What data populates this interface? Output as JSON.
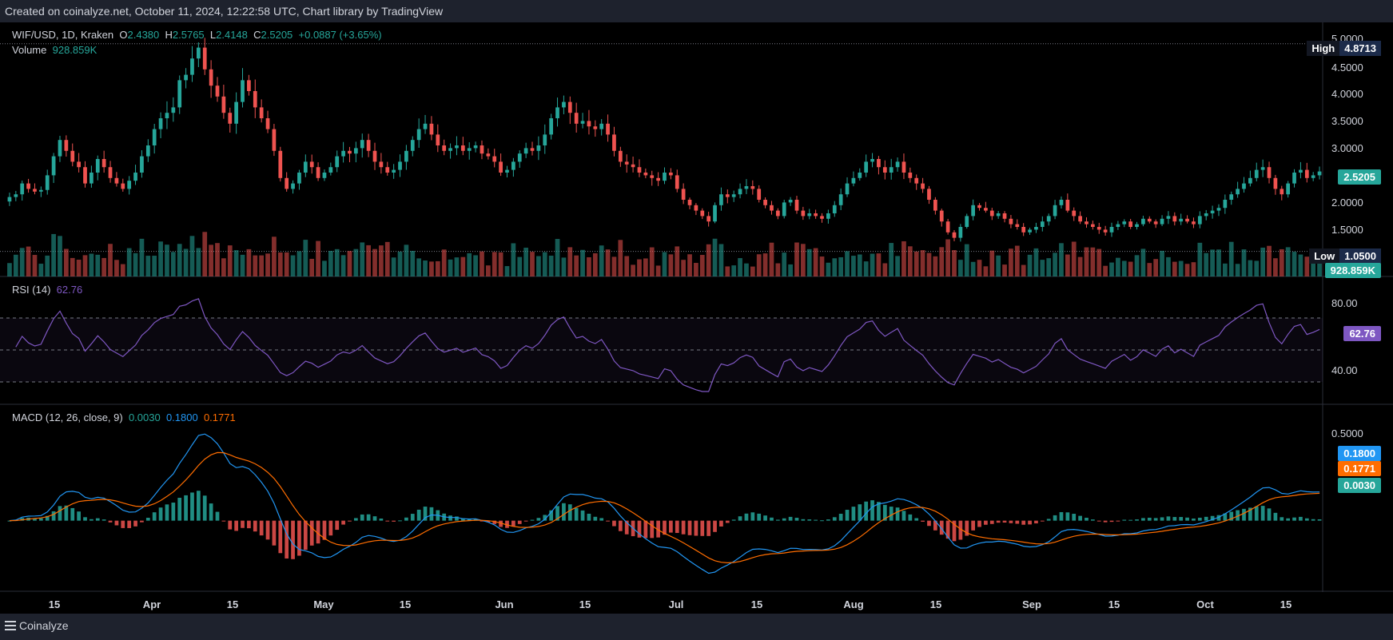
{
  "header": {
    "credit": "Created on coinalyze.net, October 11, 2024, 12:22:58 UTC, Chart library by TradingView"
  },
  "legend": {
    "symbol": "WIF/USD, 1D, Kraken",
    "o_label": "O",
    "o": "2.4380",
    "h_label": "H",
    "h": "2.5765",
    "l_label": "L",
    "l": "2.4148",
    "c_label": "C",
    "c": "2.5205",
    "change": "+0.0887 (+3.65%)",
    "volume_label": "Volume",
    "volume": "928.859K",
    "rsi_label": "RSI (14)",
    "rsi": "62.76",
    "macd_label": "MACD (12, 26, close, 9)",
    "macd_hist": "0.0030",
    "macd_line": "0.1800",
    "macd_signal": "0.1771"
  },
  "price_axis": [
    "5.0000",
    "4.5000",
    "4.0000",
    "3.5000",
    "3.0000",
    "2.5000",
    "2.0000",
    "1.5000"
  ],
  "rsi_axis": [
    "80.00",
    "40.00"
  ],
  "macd_axis": [
    "0.5000"
  ],
  "markers": {
    "high_label": "High",
    "high": "4.8713",
    "low_label": "Low",
    "low": "1.0500",
    "last_price": "2.5205",
    "last_volume": "928.859K",
    "last_rsi": "62.76",
    "macd_line_tag": "0.1800",
    "macd_signal_tag": "0.1771",
    "macd_hist_tag": "0.0030"
  },
  "x_axis": [
    "15",
    "Apr",
    "15",
    "May",
    "15",
    "Jun",
    "15",
    "Jul",
    "15",
    "Aug",
    "15",
    "Sep",
    "15",
    "Oct",
    "15"
  ],
  "footer": {
    "brand": "Coinalyze"
  },
  "colors": {
    "up": "#26a69a",
    "down": "#ef5350",
    "rsi": "#7e57c2",
    "macd": "#2196f3",
    "signal": "#ff6d00",
    "bg": "#000000"
  },
  "chart_data": {
    "type": "candlestick",
    "symbol": "WIF/USD",
    "interval": "1D",
    "price_range": [
      1.0,
      5.0
    ],
    "close_series": [
      2.05,
      2.1,
      2.3,
      2.2,
      2.15,
      2.18,
      2.45,
      2.8,
      3.1,
      2.9,
      2.7,
      2.6,
      2.3,
      2.5,
      2.75,
      2.6,
      2.4,
      2.3,
      2.2,
      2.35,
      2.5,
      2.8,
      3.0,
      3.3,
      3.5,
      3.6,
      3.7,
      4.2,
      4.3,
      4.6,
      4.8,
      4.4,
      4.1,
      3.9,
      3.6,
      3.4,
      3.8,
      4.2,
      4.0,
      3.7,
      3.5,
      3.3,
      2.9,
      2.4,
      2.2,
      2.3,
      2.5,
      2.7,
      2.6,
      2.4,
      2.5,
      2.6,
      2.8,
      2.9,
      2.85,
      2.95,
      3.1,
      2.9,
      2.7,
      2.6,
      2.5,
      2.55,
      2.7,
      2.9,
      3.1,
      3.3,
      3.4,
      3.2,
      3.0,
      2.9,
      2.95,
      3.0,
      2.9,
      2.95,
      3.0,
      2.85,
      2.8,
      2.7,
      2.5,
      2.55,
      2.7,
      2.85,
      2.95,
      2.9,
      3.0,
      3.2,
      3.5,
      3.7,
      3.8,
      3.6,
      3.4,
      3.45,
      3.35,
      3.3,
      3.4,
      3.2,
      2.9,
      2.7,
      2.65,
      2.6,
      2.5,
      2.45,
      2.4,
      2.35,
      2.5,
      2.45,
      2.2,
      2.0,
      1.9,
      1.8,
      1.7,
      1.6,
      1.9,
      2.1,
      2.05,
      2.1,
      2.2,
      2.25,
      2.2,
      2.0,
      1.9,
      1.8,
      1.7,
      1.95,
      2.0,
      1.8,
      1.7,
      1.75,
      1.7,
      1.65,
      1.75,
      1.9,
      2.1,
      2.3,
      2.4,
      2.5,
      2.7,
      2.75,
      2.6,
      2.5,
      2.6,
      2.7,
      2.5,
      2.4,
      2.3,
      2.2,
      2.0,
      1.8,
      1.6,
      1.4,
      1.3,
      1.5,
      1.7,
      1.9,
      1.85,
      1.8,
      1.7,
      1.75,
      1.65,
      1.55,
      1.5,
      1.4,
      1.45,
      1.5,
      1.6,
      1.7,
      1.9,
      2.0,
      1.8,
      1.7,
      1.6,
      1.55,
      1.5,
      1.45,
      1.4,
      1.5,
      1.55,
      1.6,
      1.5,
      1.55,
      1.65,
      1.6,
      1.55,
      1.65,
      1.7,
      1.6,
      1.65,
      1.6,
      1.55,
      1.7,
      1.75,
      1.8,
      1.85,
      2.0,
      2.1,
      2.2,
      2.3,
      2.4,
      2.55,
      2.6,
      2.4,
      2.2,
      2.1,
      2.3,
      2.5,
      2.55,
      2.4,
      2.45,
      2.5205
    ],
    "rsi_range": [
      20,
      90
    ],
    "macd_range": [
      -0.4,
      0.7
    ]
  }
}
